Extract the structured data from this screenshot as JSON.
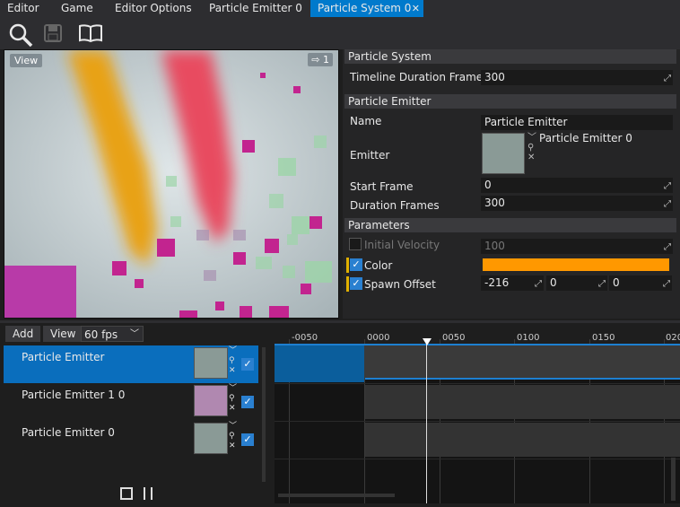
{
  "tabs": [
    {
      "label": "Editor"
    },
    {
      "label": "Game"
    },
    {
      "label": "Editor Options"
    },
    {
      "label": "Particle Emitter 0"
    },
    {
      "label": "Particle System 0",
      "close": "✕"
    }
  ],
  "toolbar": {
    "icons": [
      "search-icon",
      "save-icon",
      "book-icon"
    ]
  },
  "viewport": {
    "label": "View",
    "camera_count": "1"
  },
  "properties": {
    "particle_system": {
      "header": "Particle System",
      "timeline_label": "Timeline Duration Frames",
      "timeline_value": "300"
    },
    "particle_emitter": {
      "header": "Particle Emitter",
      "name_label": "Name",
      "name_value": "Particle Emitter",
      "emitter_label": "Emitter",
      "emitter_value": "Particle Emitter 0",
      "start_label": "Start Frame",
      "start_value": "0",
      "duration_label": "Duration Frames",
      "duration_value": "300"
    },
    "parameters": {
      "header": "Parameters",
      "velocity_label": "Initial Velocity",
      "velocity_value": "100",
      "color_label": "Color",
      "color_value": "#ff9800",
      "spawn_label": "Spawn Offset",
      "spawn_x": "-216",
      "spawn_y": "0",
      "spawn_z": "0"
    }
  },
  "bottom": {
    "add_label": "Add",
    "view_label": "View",
    "fps_label": "60 fps",
    "emitters": [
      {
        "label": "Particle Emitter",
        "selected": true
      },
      {
        "label": "Particle Emitter 1 0",
        "selected": false
      },
      {
        "label": "Particle Emitter 0",
        "selected": false
      }
    ],
    "ticks": [
      "-0050",
      "0000",
      "0050",
      "0100",
      "0150",
      "020"
    ]
  },
  "colors": {
    "accent": "#007acc",
    "selected_row": "#0a6ebd",
    "color_swatch": "#ff9800"
  }
}
